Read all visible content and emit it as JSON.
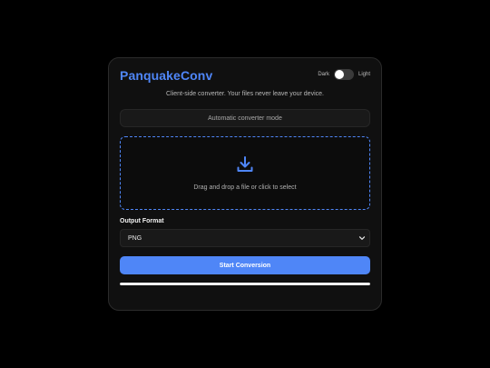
{
  "app": {
    "title": "PanquakeConv",
    "subtitle": "Client-side converter. Your files never leave your device."
  },
  "theme_toggle": {
    "dark_label": "Dark",
    "light_label": "Light",
    "state": "dark"
  },
  "mode": {
    "label": "Automatic converter mode"
  },
  "dropzone": {
    "icon": "download-tray-icon",
    "text": "Drag and drop a file or click to select"
  },
  "output_format": {
    "label": "Output Format",
    "selected": "PNG"
  },
  "actions": {
    "start_label": "Start Conversion"
  },
  "progress": {
    "fraction": 1.0
  },
  "colors": {
    "accent": "#4f86f7",
    "background": "#000000",
    "card": "#101010",
    "progress_fill": "#f2f2f2"
  }
}
